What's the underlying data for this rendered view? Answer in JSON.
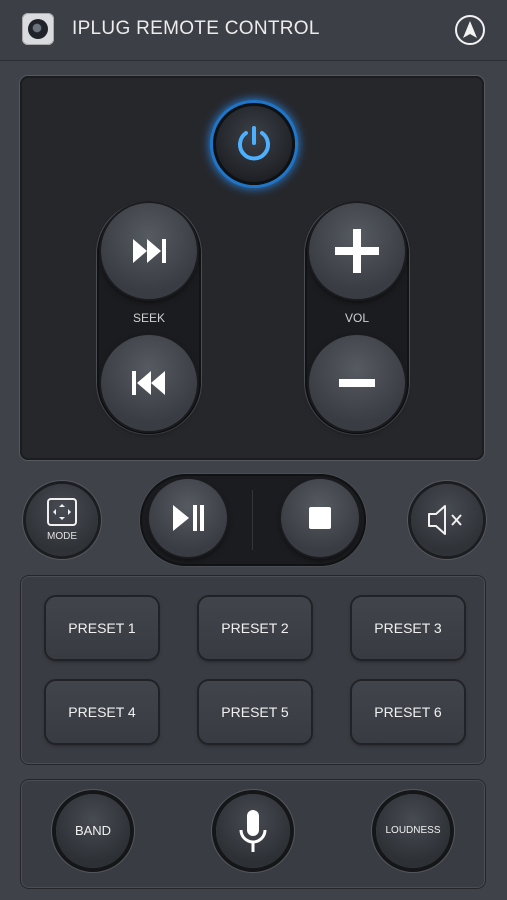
{
  "header": {
    "title": "IPLUG REMOTE CONTROL",
    "app_icon": "camera-lens-icon",
    "nav_icon": "navigation-arrow-icon"
  },
  "colors": {
    "background": "#3f4249",
    "panel": "#26272b",
    "power_glow": "#2b8cf0",
    "icon_white": "#ffffff"
  },
  "controls": {
    "power": {
      "icon": "power-icon"
    },
    "seek": {
      "label": "SEEK",
      "next_icon": "skip-forward-icon",
      "prev_icon": "skip-back-icon"
    },
    "volume": {
      "label": "VOL",
      "up_icon": "plus-icon",
      "down_icon": "minus-icon"
    },
    "mode": {
      "label": "MODE",
      "icon": "mode-icon"
    },
    "play_pause": {
      "icon": "play-pause-icon"
    },
    "stop": {
      "icon": "stop-icon"
    },
    "mute": {
      "icon": "mute-icon"
    }
  },
  "presets": [
    {
      "label": "PRESET 1"
    },
    {
      "label": "PRESET 2"
    },
    {
      "label": "PRESET 3"
    },
    {
      "label": "PRESET 4"
    },
    {
      "label": "PRESET 5"
    },
    {
      "label": "PRESET 6"
    }
  ],
  "bottom": {
    "band": "BAND",
    "mic_icon": "microphone-icon",
    "loudness": "LOUDNESS"
  }
}
